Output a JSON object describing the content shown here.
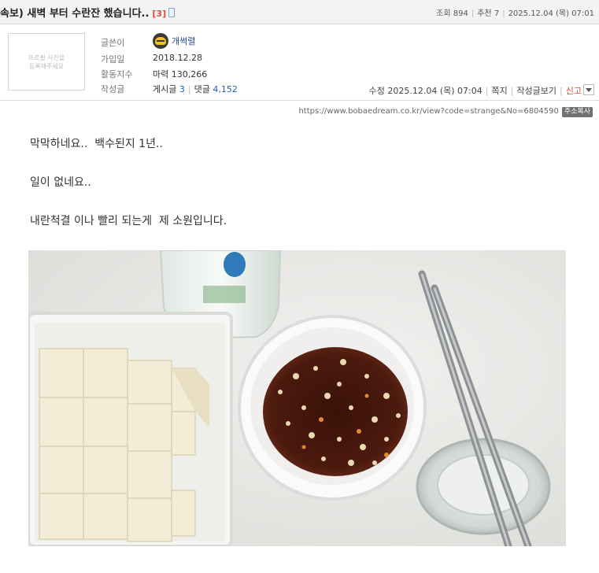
{
  "post": {
    "title": "속보) 새벽 부터 수란잔 했습니다..",
    "comment_count": "[3]",
    "views_label": "조회",
    "views": "894",
    "recommend_label": "추천",
    "recommend": "7",
    "date": "2025.12.04 (목) 07:01"
  },
  "author": {
    "photo_placeholder_line1": "프로필 사진을",
    "photo_placeholder_line2": "등록해주세요",
    "writer_label": "글쓴이",
    "nickname": "개썩렬",
    "joined_label": "가입일",
    "joined": "2018.12.28",
    "activity_label": "활동지수",
    "activity": "마력 130,266",
    "posts_label": "작성글",
    "posts_text": "게시글",
    "posts_count": "3",
    "comments_text": "댓글",
    "comments_count": "4,152"
  },
  "actions": {
    "edited": "수정 2025.12.04 (목) 07:04",
    "message": "쪽지",
    "view_posts": "작성글보기",
    "report": "신고"
  },
  "url": {
    "text": "https://www.bobaedream.co.kr/view?code=strange&No=6804590",
    "copy_label": "주소복사"
  },
  "content": {
    "lines": [
      "막막하네요..  백수된지 1년..",
      "일이 없네요..",
      "내란척결 이나 빨리 되는게  제 소원입니다."
    ]
  },
  "colors": {
    "accent_red": "#e04a3f",
    "link_blue": "#1f5fbf"
  }
}
